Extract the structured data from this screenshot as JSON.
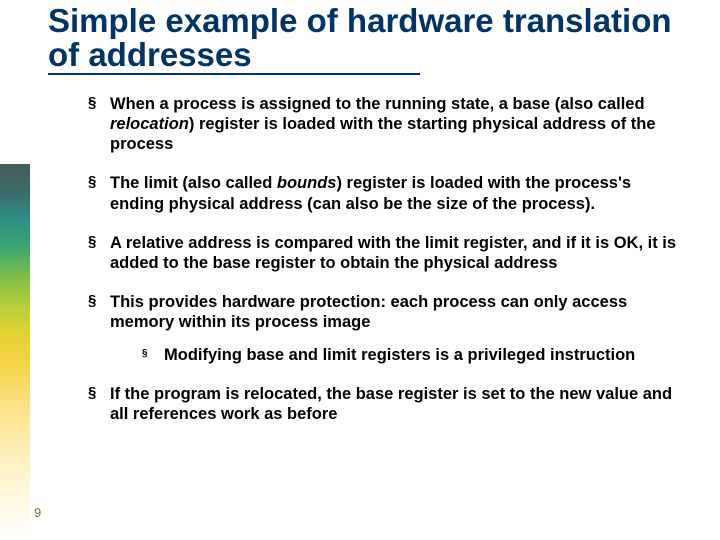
{
  "title": "Simple example of hardware translation of addresses",
  "bullets": {
    "b1_pre": "When a process is assigned to the running state, a base (also called ",
    "b1_em": "relocation",
    "b1_post": ") register is loaded with the starting physical address of the process",
    "b2_pre": "The limit (also called ",
    "b2_em": "bounds",
    "b2_post": ") register is loaded with the process's ending physical address (can also be the size of the process).",
    "b3": "A relative address is compared with the limit register, and if it is OK, it is added to the base register to obtain the physical address",
    "b4": "This provides hardware protection: each process can only access memory within its process image",
    "b4a": "Modifying base and limit registers is a privileged instruction",
    "b5": "If the program is relocated,  the base register is set to the new value and all references work as before"
  },
  "page_number": "9"
}
